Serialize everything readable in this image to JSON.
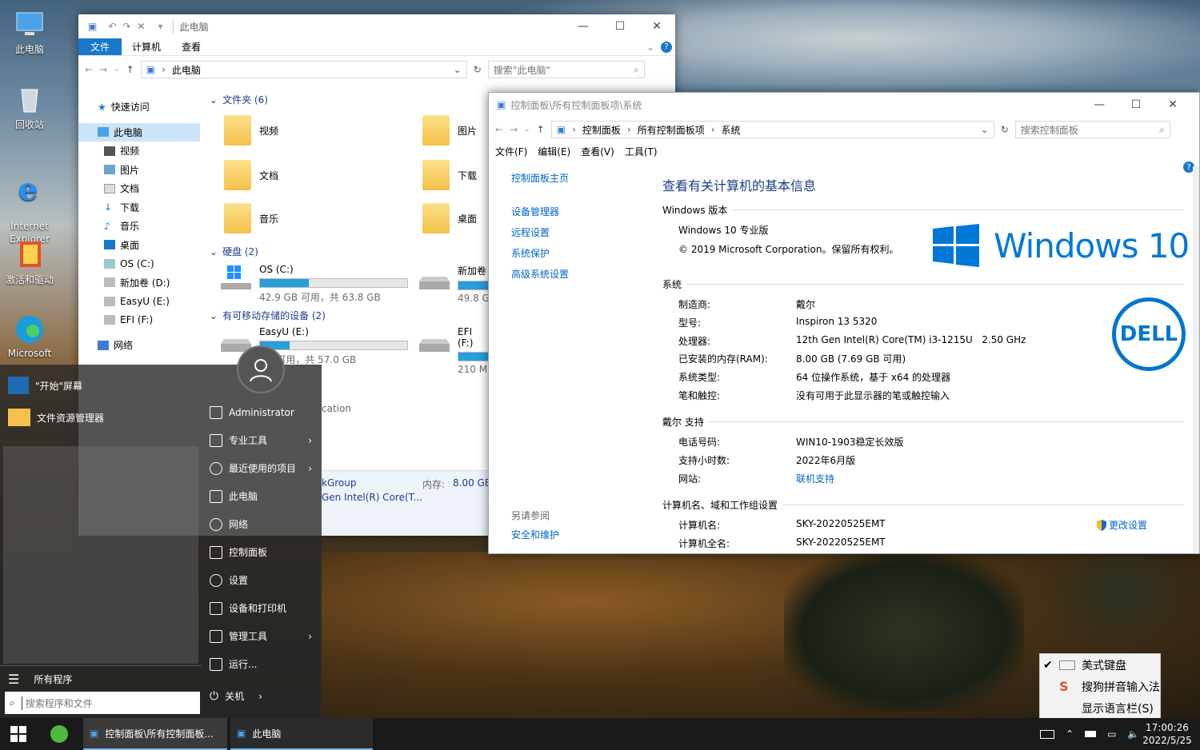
{
  "desktop": {
    "icons": [
      {
        "label": "此电脑"
      },
      {
        "label": "回收站"
      },
      {
        "label": "Internet\nExplorer"
      },
      {
        "label": "激活和驱动"
      },
      {
        "label": "Microsoft"
      }
    ]
  },
  "explorer": {
    "title": "此电脑",
    "ribbon_tabs": [
      "文件",
      "计算机",
      "查看"
    ],
    "address": "此电脑",
    "search_placeholder": "搜索\"此电脑\"",
    "nav": {
      "quick_access": "快速访问",
      "this_pc": "此电脑",
      "items": [
        "视频",
        "图片",
        "文档",
        "下载",
        "音乐",
        "桌面",
        "OS (C:)",
        "新加卷 (D:)",
        "EasyU (E:)",
        "EFI (F:)"
      ],
      "network": "网络"
    },
    "groups": {
      "folders": "文件夹 (6)",
      "disks": "硬盘 (2)",
      "removable": "有可移动存储的设备 (2)"
    },
    "folders": [
      "视频",
      "图片",
      "文档",
      "下载",
      "音乐",
      "桌面"
    ],
    "drives": [
      {
        "name": "OS (C:)",
        "info": "42.9 GB 可用，共 63.8 GB",
        "used_pct": 33
      },
      {
        "name": "新加卷",
        "info": "49.8 G",
        "used_pct": 20
      },
      {
        "name": "EasyU (E:)",
        "info": "GB 可用，共 57.0 GB",
        "used_pct": 20
      },
      {
        "name": "EFI (F:)",
        "info": "210 M",
        "used_pct": 50
      }
    ],
    "detail": {
      "fragment1": "cation",
      "workgroup": "kGroup",
      "cpu": "Gen Intel(R) Core(T...",
      "mem_label": "内存:",
      "mem_value": "8.00 GB"
    }
  },
  "cpanel": {
    "title": "控制面板\\所有控制面板项\\系统",
    "breadcrumb": [
      "控制面板",
      "所有控制面板项",
      "系统"
    ],
    "search_placeholder": "搜索控制面板",
    "menu": [
      "文件(F)",
      "编辑(E)",
      "查看(V)",
      "工具(T)"
    ],
    "left_links": [
      "控制面板主页",
      "设备管理器",
      "远程设置",
      "系统保护",
      "高级系统设置"
    ],
    "see_also": "另请参阅",
    "see_also_link": "安全和维护",
    "heading": "查看有关计算机的基本信息",
    "edition_section": "Windows 版本",
    "edition": "Windows 10 专业版",
    "copyright": "© 2019 Microsoft Corporation。保留所有权利。",
    "logo_text": "Windows 10",
    "system_section": "系统",
    "system": [
      {
        "k": "制造商:",
        "v": "戴尔"
      },
      {
        "k": "型号:",
        "v": "Inspiron 13 5320"
      },
      {
        "k": "处理器:",
        "v": "12th Gen Intel(R) Core(TM) i3-1215U   2.50 GHz"
      },
      {
        "k": "已安装的内存(RAM):",
        "v": "8.00 GB (7.69 GB 可用)"
      },
      {
        "k": "系统类型:",
        "v": "64 位操作系统，基于 x64 的处理器"
      },
      {
        "k": "笔和触控:",
        "v": "没有可用于此显示器的笔或触控输入"
      }
    ],
    "dell_logo": "DELL",
    "support_section": "戴尔 支持",
    "support": [
      {
        "k": "电话号码:",
        "v": "WIN10-1903稳定长效版"
      },
      {
        "k": "支持小时数:",
        "v": "2022年6月版"
      },
      {
        "k": "网站:",
        "v": "联机支持"
      }
    ],
    "computer_section": "计算机名、域和工作组设置",
    "computer": [
      {
        "k": "计算机名:",
        "v": "SKY-20220525EMT"
      },
      {
        "k": "计算机全名:",
        "v": "SKY-20220525EMT"
      }
    ],
    "change_settings": "更改设置"
  },
  "start_menu": {
    "left": [
      "\"开始\"屏幕",
      "文件资源管理器"
    ],
    "all_programs": "所有程序",
    "search_placeholder": "搜索程序和文件",
    "user": "Administrator",
    "right": [
      "专业工具",
      "最近使用的项目",
      "此电脑",
      "网络",
      "控制面板",
      "设置",
      "设备和打印机",
      "管理工具",
      "运行..."
    ],
    "shutdown": "关机"
  },
  "ime_menu": [
    "美式键盘",
    "搜狗拼音输入法",
    "显示语言栏(S)"
  ],
  "taskbar": {
    "items": [
      "控制面板\\所有控制面板...",
      "此电脑"
    ],
    "time": "17:00:26",
    "date": "2022/5/25"
  },
  "colors": {
    "accent": "#0078d7",
    "link": "#0066cc",
    "heading": "#1e3c8c"
  }
}
